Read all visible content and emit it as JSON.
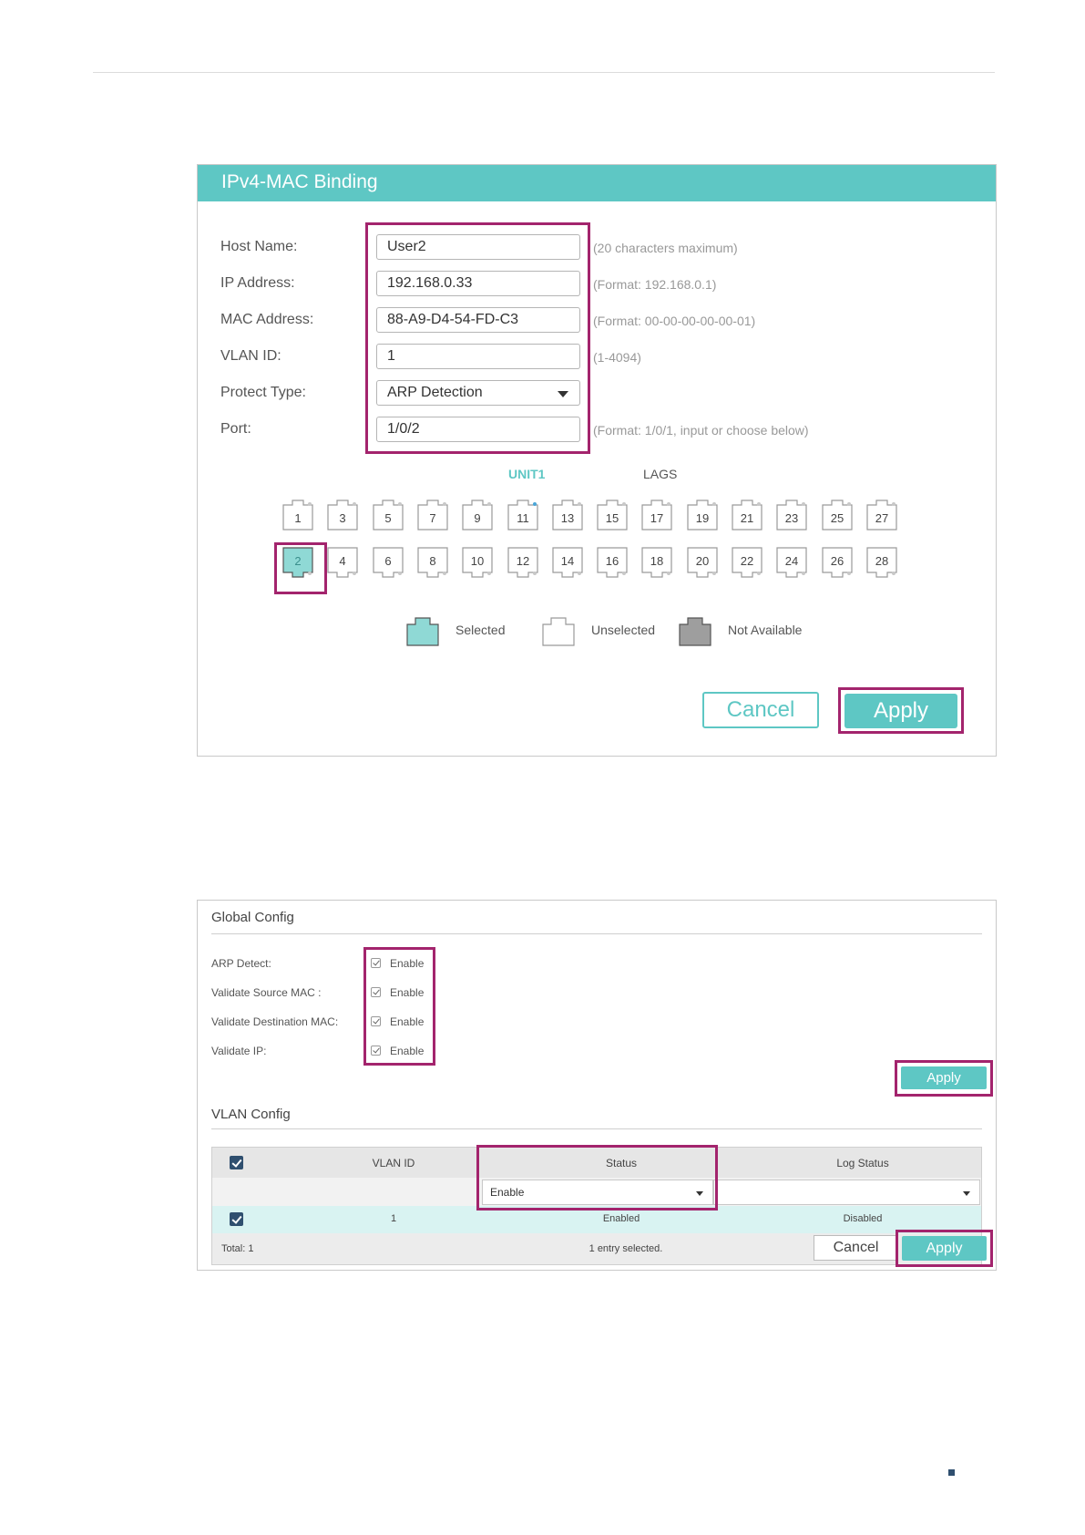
{
  "panel1": {
    "title": "IPv4-MAC Binding",
    "fields": {
      "host_name": {
        "label": "Host Name:",
        "value": "User2",
        "hint": "(20 characters maximum)"
      },
      "ip_address": {
        "label": "IP Address:",
        "value": "192.168.0.33",
        "hint": "(Format: 192.168.0.1)"
      },
      "mac_address": {
        "label": "MAC Address:",
        "value": "88-A9-D4-54-FD-C3",
        "hint": "(Format: 00-00-00-00-00-01)"
      },
      "vlan_id": {
        "label": "VLAN ID:",
        "value": "1",
        "hint": "(1-4094)"
      },
      "protect_type": {
        "label": "Protect Type:",
        "value": "ARP Detection"
      },
      "port": {
        "label": "Port:",
        "value": "1/0/2",
        "hint": "(Format: 1/0/1, input or choose below)"
      }
    },
    "unit_label": "UNIT1",
    "lags_label": "LAGS",
    "ports_top": [
      "1",
      "3",
      "5",
      "7",
      "9",
      "11",
      "13",
      "15",
      "17",
      "19",
      "21",
      "23",
      "25",
      "27"
    ],
    "ports_bottom": [
      "2",
      "4",
      "6",
      "8",
      "10",
      "12",
      "14",
      "16",
      "18",
      "20",
      "22",
      "24",
      "26",
      "28"
    ],
    "selected_port": "2",
    "legend": {
      "selected": "Selected",
      "unselected": "Unselected",
      "not_available": "Not Available"
    },
    "cancel_label": "Cancel",
    "apply_label": "Apply",
    "colors": {
      "accent": "#5ec7c4",
      "highlight": "#a3246d"
    }
  },
  "panel2": {
    "global_title": "Global Config",
    "rows": [
      {
        "label": "ARP Detect:",
        "option": "Enable",
        "checked": true
      },
      {
        "label": "Validate Source MAC :",
        "option": "Enable",
        "checked": true
      },
      {
        "label": "Validate Destination MAC:",
        "option": "Enable",
        "checked": true
      },
      {
        "label": "Validate IP:",
        "option": "Enable",
        "checked": true
      }
    ],
    "global_apply": "Apply",
    "vlan_title": "VLAN Config",
    "table": {
      "headers": [
        "VLAN ID",
        "Status",
        "Log Status"
      ],
      "filter_status": "Enable",
      "filter_log_status": "",
      "row": {
        "vlan_id": "1",
        "status": "Enabled",
        "log_status": "Disabled"
      },
      "total": "Total: 1",
      "selected_info": "1 entry selected.",
      "cancel": "Cancel",
      "apply": "Apply"
    }
  }
}
